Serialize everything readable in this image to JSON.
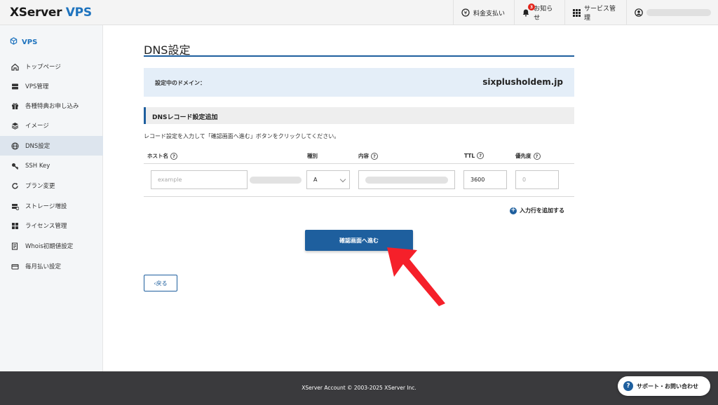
{
  "header": {
    "logo_main": "XServer",
    "logo_accent": "VPS",
    "payment_label": "料金支払い",
    "notice_label": "お知らせ",
    "notice_count": "3",
    "service_label": "サービス管理"
  },
  "sidebar": {
    "title": "VPS",
    "items": [
      {
        "label": "トップページ",
        "icon": "home-icon"
      },
      {
        "label": "VPS管理",
        "icon": "server-icon"
      },
      {
        "label": "各種特典お申し込み",
        "icon": "gift-icon"
      },
      {
        "label": "イメージ",
        "icon": "layers-icon"
      },
      {
        "label": "DNS設定",
        "icon": "globe-icon"
      },
      {
        "label": "SSH Key",
        "icon": "key-icon"
      },
      {
        "label": "プラン変更",
        "icon": "refresh-icon"
      },
      {
        "label": "ストレージ増設",
        "icon": "storage-icon"
      },
      {
        "label": "ライセンス管理",
        "icon": "windows-icon"
      },
      {
        "label": "Whois初期値設定",
        "icon": "document-icon"
      },
      {
        "label": "毎月払い設定",
        "icon": "card-icon"
      }
    ]
  },
  "main": {
    "page_title": "DNS設定",
    "domain_label": "設定中のドメイン：",
    "domain_value": "sixplusholdem.jp",
    "section_title": "DNSレコード設定追加",
    "instruction": "レコード設定を入力して「確認画面へ進む」ボタンをクリックしてください。",
    "columns": {
      "host": "ホスト名",
      "type": "種別",
      "content": "内容",
      "ttl": "TTL",
      "priority": "優先度"
    },
    "row": {
      "host_placeholder": "example",
      "type_value": "A",
      "ttl_value": "3600",
      "priority_placeholder": "0"
    },
    "add_row_label": "入力行を追加する",
    "confirm_label": "確認画面へ進む",
    "back_label": "戻る"
  },
  "footer": {
    "copyright": "XServer Account © 2003-2025 XServer Inc.",
    "support_label": "サポート・お問い合わせ"
  },
  "colors": {
    "primary": "#1e5f9e",
    "brand_blue": "#1e73be",
    "badge_red": "#e2231a",
    "arrow_red": "#f5202a"
  }
}
